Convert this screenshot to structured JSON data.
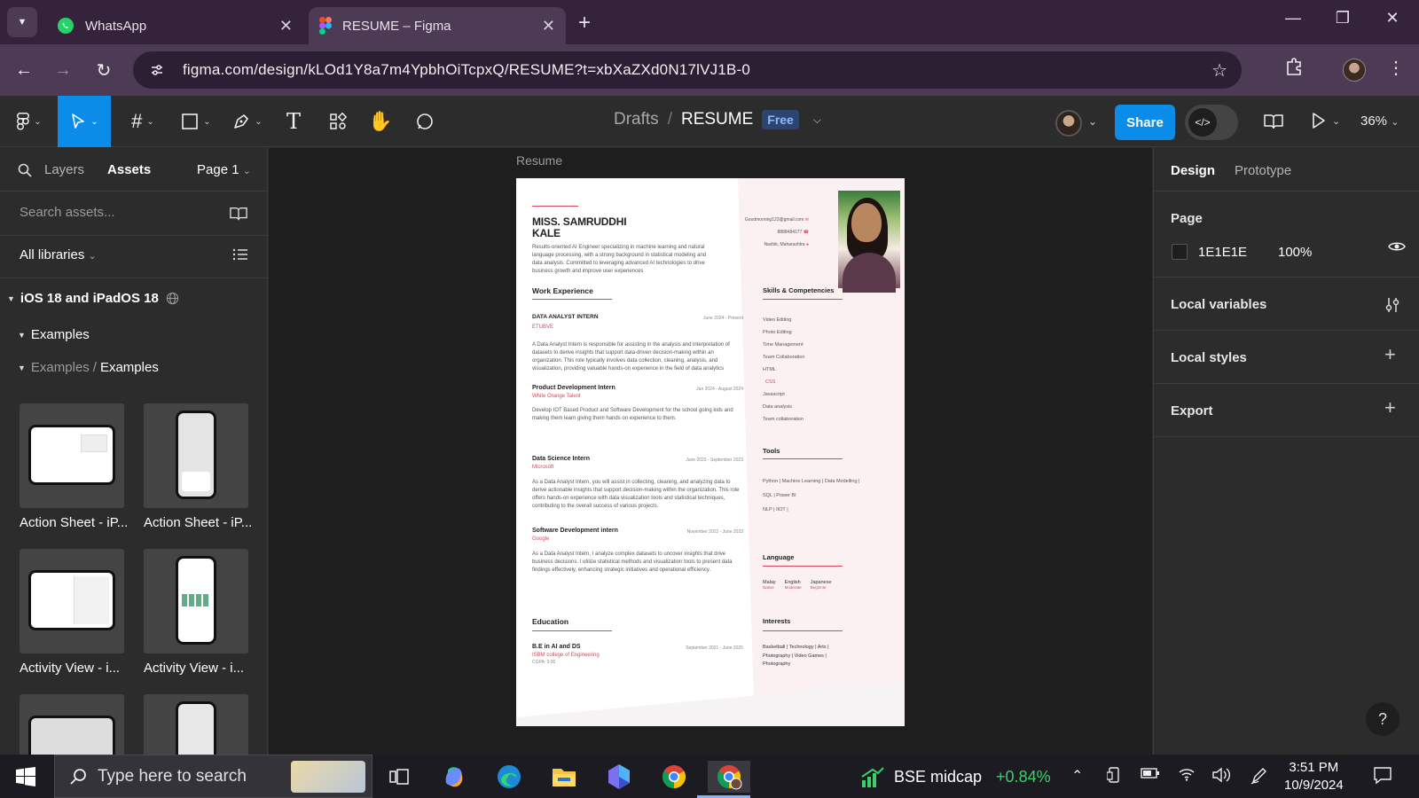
{
  "browser": {
    "tabs": [
      {
        "title": "WhatsApp",
        "active": false
      },
      {
        "title": "RESUME – Figma",
        "active": true
      }
    ],
    "url": "figma.com/design/kLOd1Y8a7m4YpbhOiTcpxQ/RESUME?t=xbXaZXd0N17lVJ1B-0"
  },
  "figma_toolbar": {
    "breadcrumb_parent": "Drafts",
    "separator": "/",
    "file_name": "RESUME",
    "plan_badge": "Free",
    "share_label": "Share",
    "zoom": "36%"
  },
  "left_panel": {
    "tab_layers": "Layers",
    "tab_assets": "Assets",
    "page_selector": "Page 1",
    "search_placeholder": "Search assets...",
    "libraries_filter": "All libraries",
    "library_name": "iOS 18 and iPadOS 18",
    "group": "Examples",
    "subgroup_parent": "Examples",
    "subgroup_child": "Examples",
    "assets": [
      {
        "label": "Action Sheet - iP..."
      },
      {
        "label": "Action Sheet - iP..."
      },
      {
        "label": "Activity View - i..."
      },
      {
        "label": "Activity View - i..."
      }
    ]
  },
  "canvas": {
    "frame_label": "Resume",
    "resume": {
      "name_line1": "MISS. SAMRUDDHI",
      "name_line2": "KALE",
      "summary": "Results-oriented AI Engineer specializing in machine learning and natural language processing, with a strong background in statistical modeling and data analysis. Committed to leveraging advanced AI technologies to drive business growth and improve user experiences",
      "email": "Goodmorning123@gmail.com",
      "phone": "8888484177",
      "location": "Nashik, Maharashtra",
      "work_heading": "Work Experience",
      "jobs": [
        {
          "role": "DATA ANALYST INTERN",
          "org": "ETUBVE",
          "date": "June 2024 - Present",
          "desc": "A Data Analyst Intern is responsible for assisting in the analysis and interpretation of datasets to derive insights that support data-driven decision-making within an organization. This role typically involves data collection, cleaning, analysis, and visualization, providing valuable hands-on experience in the field of data analytics"
        },
        {
          "role": "Product Development Intern",
          "org": "White Orange Talent",
          "date": "Jan 2024 - August 2024",
          "desc": "Develop IOT Based Product and Software Development for the school going kids and making them learn giving them hands on experience to them."
        },
        {
          "role": "Data Science Intern",
          "org": "Microsoft",
          "date": "June 2023 - September 2023",
          "desc": "As a Data Analyst Intern, you will assist in collecting, cleaning, and analyzing data to derive actionable insights that support decision-making within the organization. This role offers hands-on experience with data visualization tools and statistical techniques, contributing to the overall success of various projects."
        },
        {
          "role": "Software Development intern",
          "org": "Google",
          "date": "November 2022 - June 2023",
          "desc": "As a Data Analyst Intern, I analyze complex datasets to uncover insights that drive business decisions. I utilize statistical methods and visualization tools to present data findings effectively, enhancing strategic initiatives and operational efficiency."
        }
      ],
      "education_heading": "Education",
      "degree": "B.E in AI and DS",
      "college": "ISBM college of Engineering",
      "cgpa": "CGPA: 9.00",
      "edu_date": "September 2021 - June 2025",
      "skills_heading": "Skills & Competencies",
      "skills": [
        "Video Editing",
        "Photo Editing",
        "Time Management",
        "Team Collaboration",
        "HTML",
        "CSS",
        "Javascript",
        "Data analysis",
        "Team collaboration"
      ],
      "tools_heading": "Tools",
      "tools_line1": "Python | Machine Learning | Data Modelling |",
      "tools_line2": "SQL | Power BI",
      "tools_line3": "NLP | IIOT |",
      "language_heading": "Language",
      "languages": [
        {
          "name": "Malay",
          "level": "Native"
        },
        {
          "name": "English",
          "level": "Moderate"
        },
        {
          "name": "Japanese",
          "level": "Beginner"
        }
      ],
      "interests_heading": "Interests",
      "interests_line1": "Basketball | Technology | Arts |",
      "interests_line2": "Photography | Video Games |",
      "interests_line3": "Photography"
    }
  },
  "right_panel": {
    "tab_design": "Design",
    "tab_prototype": "Prototype",
    "page_section": "Page",
    "page_color": "1E1E1E",
    "page_opacity": "100%",
    "local_variables": "Local variables",
    "local_styles": "Local styles",
    "export": "Export",
    "help": "?"
  },
  "taskbar": {
    "search_placeholder": "Type here to search",
    "stock_name": "BSE midcap",
    "stock_change": "+0.84%",
    "time": "3:51 PM",
    "date": "10/9/2024"
  },
  "colors": {
    "figma_blue": "#0c8ce9",
    "accent_red": "#d8485c",
    "canvas_bg": "#1e1e1e",
    "panel_bg": "#2c2c2c",
    "browser_chrome": "#4d3a55"
  }
}
